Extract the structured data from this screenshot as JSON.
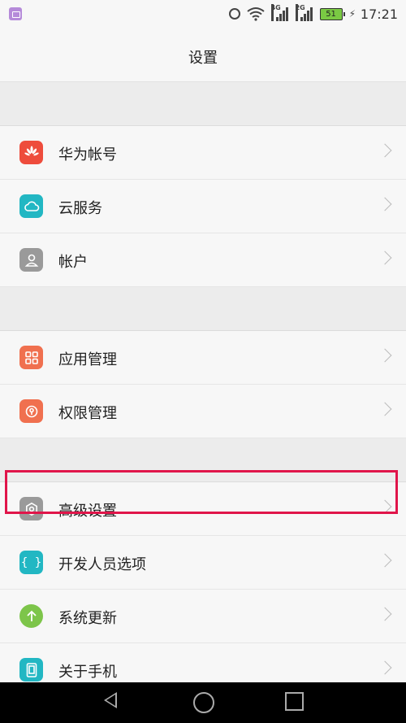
{
  "status_bar": {
    "time": "17:21",
    "battery": "51",
    "sim1": "4G",
    "sim2": "2G"
  },
  "header": {
    "title": "设置"
  },
  "groups": [
    {
      "items": [
        {
          "label": "华为帐号",
          "icon": "huawei-icon",
          "color": "#ee4c3c"
        },
        {
          "label": "云服务",
          "icon": "cloud-icon",
          "color": "#22b7c3"
        },
        {
          "label": "帐户",
          "icon": "person-icon",
          "color": "#9a9a9a"
        }
      ]
    },
    {
      "items": [
        {
          "label": "应用管理",
          "icon": "grid-icon",
          "color": "#f0704f"
        },
        {
          "label": "权限管理",
          "icon": "key-icon",
          "color": "#f0704f"
        }
      ]
    },
    {
      "items": [
        {
          "label": "高级设置",
          "icon": "gear-icon",
          "color": "#9a9a9a"
        },
        {
          "label": "开发人员选项",
          "icon": "braces-icon",
          "color": "#22b7c3"
        },
        {
          "label": "系统更新",
          "icon": "arrow-up-icon",
          "color": "#7dc54a"
        },
        {
          "label": "关于手机",
          "icon": "phone-icon",
          "color": "#22b7c3"
        }
      ]
    }
  ],
  "highlight_color": "#e0154a"
}
